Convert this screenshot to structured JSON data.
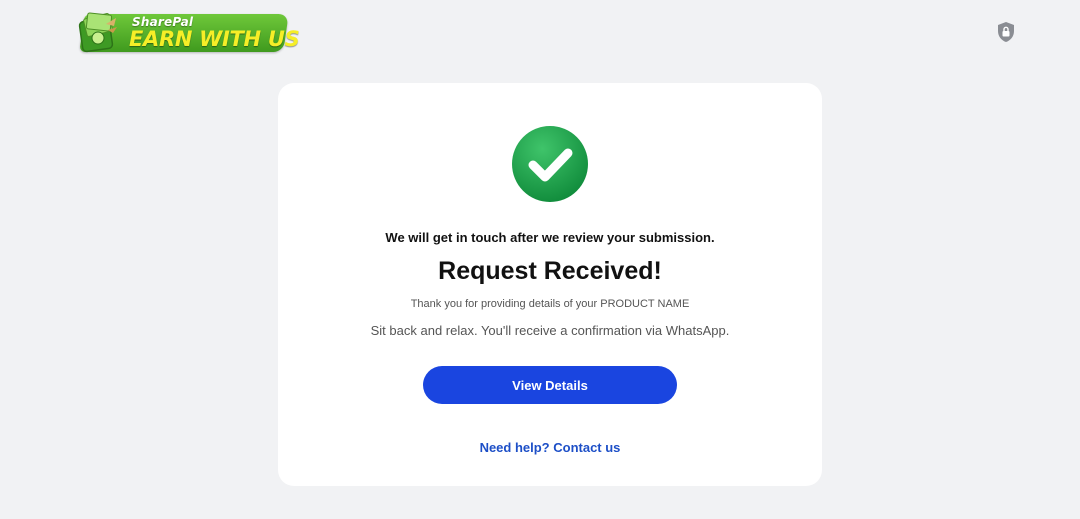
{
  "header": {
    "logo": {
      "brand": "SharePal",
      "tagline": "EARN WITH US"
    },
    "privacy_icon": "shield-lock-icon"
  },
  "card": {
    "icon": "check-circle-icon",
    "touch_message": "We will get in touch after we review your submission.",
    "title": "Request Received!",
    "thanks_message": "Thank you for providing details of your PRODUCT NAME",
    "relax_message": "Sit back and relax. You'll receive a confirmation via WhatsApp.",
    "view_details_label": "View Details",
    "help_link_label": "Need help? Contact us"
  },
  "colors": {
    "page_background": "#f1f2f4",
    "primary_button": "#1a45e0",
    "link": "#1d4fc7",
    "success": "#1fa24a"
  }
}
